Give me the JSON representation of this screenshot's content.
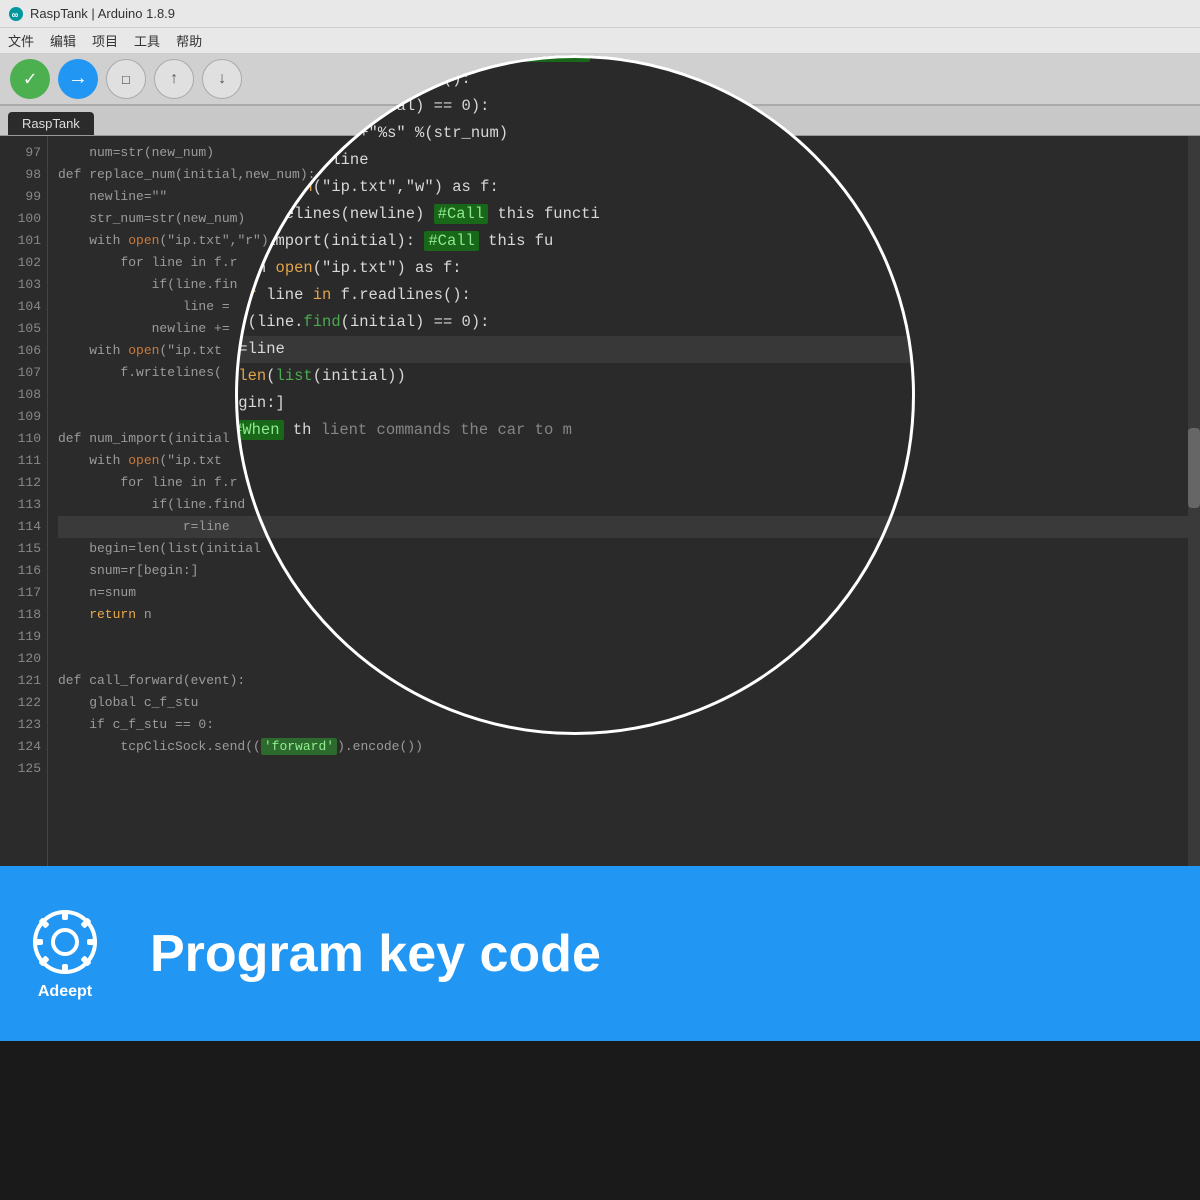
{
  "titleBar": {
    "icon": "●",
    "text": "RaspTank | Arduino 1.8.9"
  },
  "menuBar": {
    "items": [
      "文件",
      "编辑",
      "项目",
      "工具",
      "帮助"
    ]
  },
  "tab": {
    "label": "RaspTank"
  },
  "codeLines": [
    {
      "num": "97",
      "text": "",
      "tokens": []
    },
    {
      "num": "98",
      "text": "def replace_num(initial,new_num):",
      "highlight": false
    },
    {
      "num": "99",
      "text": "    newline=\"\"",
      "highlight": false
    },
    {
      "num": "100",
      "text": "    str_num=str(new_num)",
      "highlight": false
    },
    {
      "num": "101",
      "text": "    with open(\"ip.txt\",\"r\") as f:",
      "highlight": false
    },
    {
      "num": "102",
      "text": "        for line in f.readlines():",
      "highlight": false
    },
    {
      "num": "103",
      "text": "            if(line.find(initial) == 0):",
      "highlight": false
    },
    {
      "num": "104",
      "text": "                line = initial+\"%s\" %(str_num)",
      "highlight": false
    },
    {
      "num": "105",
      "text": "            newline += line",
      "highlight": false
    },
    {
      "num": "106",
      "text": "    with open(\"ip.txt\",\"w\") as f:",
      "highlight": false
    },
    {
      "num": "107",
      "text": "        f.writelines(newline)",
      "highlight": false
    },
    {
      "num": "108",
      "text": "",
      "highlight": false
    },
    {
      "num": "109",
      "text": "",
      "highlight": false
    },
    {
      "num": "110",
      "text": "def num_import(initial):",
      "highlight": false
    },
    {
      "num": "111",
      "text": "    with open(\"ip.txt\") as f:",
      "highlight": false
    },
    {
      "num": "112",
      "text": "        for line in f.readlines():",
      "highlight": false
    },
    {
      "num": "113",
      "text": "            if(line.find(initial) == 0):",
      "highlight": false
    },
    {
      "num": "114",
      "text": "                r=line",
      "highlight": true
    },
    {
      "num": "115",
      "text": "    begin=len(list(initial))",
      "highlight": false
    },
    {
      "num": "116",
      "text": "    snum=r[begin:]",
      "highlight": false
    },
    {
      "num": "117",
      "text": "    n=snum",
      "highlight": false
    },
    {
      "num": "118",
      "text": "    return n",
      "highlight": false
    },
    {
      "num": "119",
      "text": "",
      "highlight": false
    },
    {
      "num": "120",
      "text": "",
      "highlight": false
    },
    {
      "num": "121",
      "text": "def call_forward(event):",
      "highlight": false
    },
    {
      "num": "122",
      "text": "    global c_f_stu",
      "highlight": false
    },
    {
      "num": "123",
      "text": "    if c_f_stu == 0:",
      "highlight": false
    },
    {
      "num": "124",
      "text": "        tcpClicSock.send(('forward').encode())",
      "highlight": false
    }
  ],
  "circleCode": [
    "    open(\"ip.txt\",\"r\") as f:",
    "for line in f.readlines():",
    "    if(line.find(initial) == 0):",
    "        line = initial+\"%s\" %(str_num)",
    "    newline += line",
    "with open(\"ip.txt\",\"w\") as f:",
    "    f.writelines(newline)          #Call this functi",
    "",
    "",
    "    num_import(initial):           #Call this fu",
    "    with open(\"ip.txt\") as f:",
    "    for line in f.readlines():",
    "        if(line.find(initial) == 0):",
    "            r=line",
    "=len(list(initial))",
    "egin:]",
    "",
    "#When th              lient commands the car to m"
  ],
  "banner": {
    "logoText": "Adeept",
    "title": "Program key code"
  },
  "colors": {
    "editorBg": "#2b2b2b",
    "bannerBg": "#2196F3",
    "highlightGreen": "#2d8a2d",
    "titleBarBg": "#e8e8e8"
  }
}
